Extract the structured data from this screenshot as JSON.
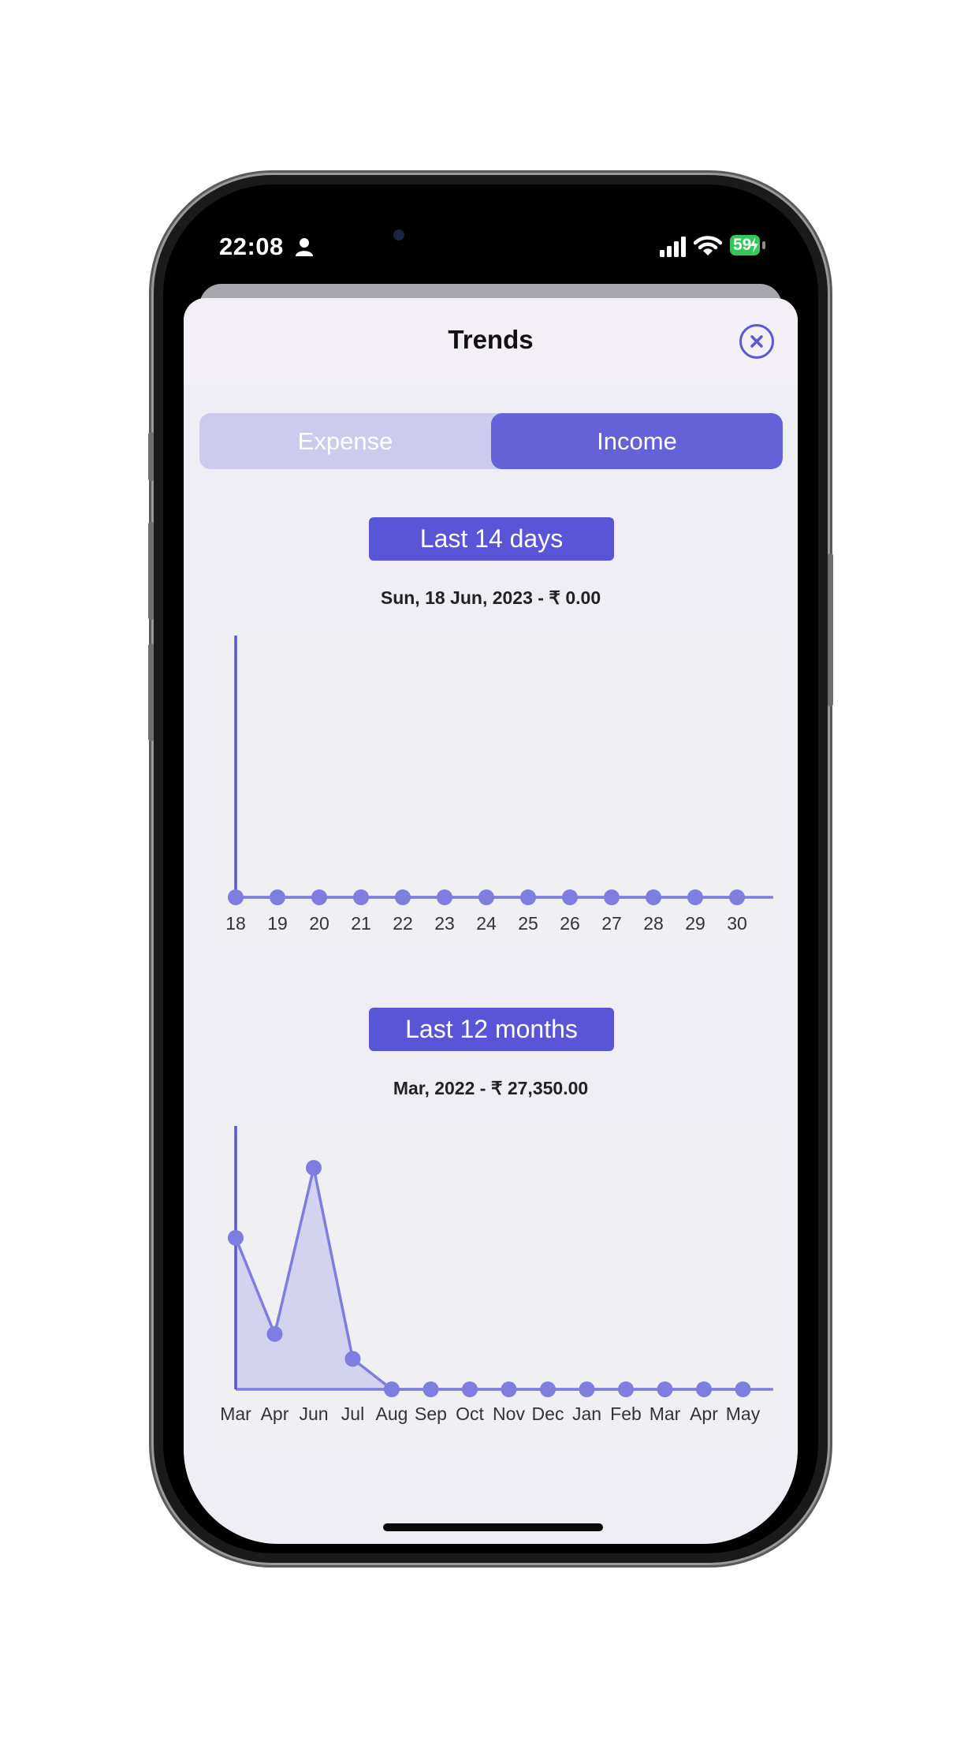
{
  "status_bar": {
    "time": "22:08",
    "battery": "59"
  },
  "sheet": {
    "title": "Trends"
  },
  "segmented_control": {
    "options": [
      "Expense",
      "Income"
    ],
    "selected": "Income"
  },
  "colors": {
    "accent": "#5856d6",
    "segment_bg": "#cccbee",
    "chart_line": "#7f7ddf",
    "chart_fill": "#d3d2ef",
    "panel_bg": "#f0f0f2"
  },
  "charts": [
    {
      "range_label": "Last 14 days",
      "selected_caption": "Sun, 18 Jun, 2023 - ₹ 0.00"
    },
    {
      "range_label": "Last 12 months",
      "selected_caption": "Mar, 2022 - ₹ 27,350.00"
    }
  ],
  "chart_data": [
    {
      "type": "line",
      "title": "Last 14 days",
      "categories": [
        "18",
        "19",
        "20",
        "21",
        "22",
        "23",
        "24",
        "25",
        "26",
        "27",
        "28",
        "29",
        "30"
      ],
      "series": [
        {
          "values": [
            0,
            0,
            0,
            0,
            0,
            0,
            0,
            0,
            0,
            0,
            0,
            0,
            0
          ]
        }
      ],
      "selected_index": 0,
      "selected_value": 0,
      "grid": false
    },
    {
      "type": "area",
      "title": "Last 12 months",
      "categories": [
        "Mar",
        "Apr",
        "Jun",
        "Jul",
        "Aug",
        "Sep",
        "Oct",
        "Nov",
        "Dec",
        "Jan",
        "Feb",
        "Mar",
        "Apr",
        "May"
      ],
      "series": [
        {
          "values": [
            27350,
            10000,
            40000,
            5500,
            0,
            0,
            0,
            0,
            0,
            0,
            0,
            0,
            0,
            0
          ]
        }
      ],
      "selected_index": 0,
      "selected_value": 27350,
      "ylim": [
        0,
        44000
      ],
      "grid": false
    }
  ]
}
